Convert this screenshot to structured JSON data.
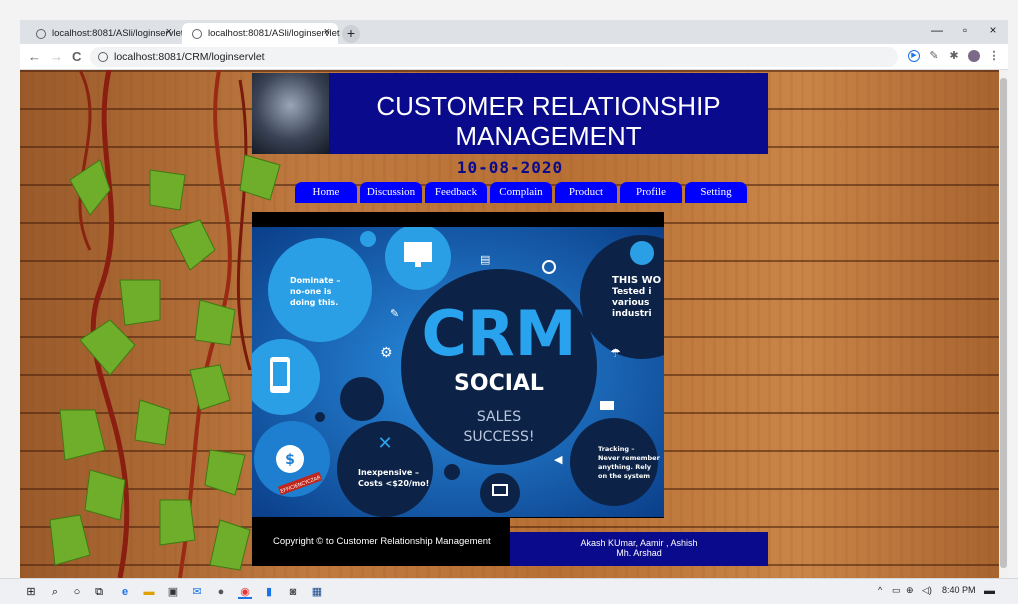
{
  "browser": {
    "tabs": [
      {
        "title": "localhost:8081/ASli/loginservlet",
        "close": "×"
      },
      {
        "title": "localhost:8081/ASli/loginservlet",
        "close": "×"
      }
    ],
    "new_tab": "+",
    "window_controls": {
      "minimize": "—",
      "restore": "▫",
      "close": "×"
    },
    "nav": {
      "back": "←",
      "forward": "→",
      "reload": "C"
    },
    "url": "localhost:8081/CRM/loginservlet",
    "toolbar_icons": [
      "play-icon",
      "pen-icon",
      "extensions-icon",
      "profile-avatar",
      "menu-icon"
    ]
  },
  "site": {
    "title_line1": "CUSTOMER RELATIONSHIP",
    "title_line2": "MANAGEMENT",
    "date": "10-08-2020",
    "nav": [
      "Home",
      "Discussion",
      "Feedback",
      "Complain",
      "Product",
      "Profile",
      "Setting"
    ],
    "banner": {
      "big": "CRM",
      "social": "SOCIAL",
      "sales": "SALES",
      "success": "SUCCESS!",
      "dominate": [
        "Dominate –",
        "no-one is",
        "doing this."
      ],
      "inexpensive": [
        "Inexpensive –",
        "Costs <$20/mo!"
      ],
      "tracking": [
        "Tracking –",
        "Never remember",
        "anything. Rely",
        "on the system"
      ],
      "tested": [
        "THIS WO",
        "Tested i",
        "various",
        "industri"
      ],
      "stamp": "EFFICIENCYCZAR"
    },
    "footer_copyright": "Copyright © to Customer Relationship Management",
    "footer_authors_line1": "Akash KUmar, Aamir , Ashish",
    "footer_authors_line2": "Mh. Arshad"
  },
  "taskbar": {
    "icons": [
      "windows-start-icon",
      "search-icon",
      "cortana-icon",
      "task-view-icon",
      "edge-icon",
      "file-explorer-icon",
      "store-icon",
      "mail-icon",
      "app-icon",
      "chrome-icon",
      "app2-icon",
      "app3-icon",
      "app4-icon"
    ],
    "time": "8:40 PM",
    "tray_caret": "^"
  },
  "colors": {
    "header_bg": "#0a0a8c",
    "nav_bg": "#0000ff",
    "date_color": "#0a0a8c"
  }
}
